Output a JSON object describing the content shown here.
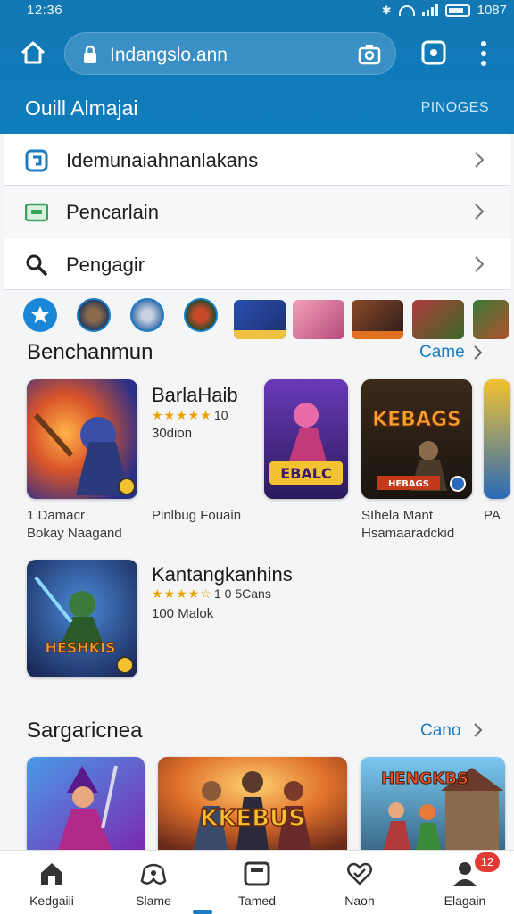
{
  "status_bar": {
    "time": "12:36",
    "battery": "1087"
  },
  "browser": {
    "url": "Indangslo.ann"
  },
  "header": {
    "title": "Ouill Almajai",
    "action": "PINOGES"
  },
  "list_rows": [
    {
      "label": "Idemunaiahnanlakans",
      "icon": "app-square-icon"
    },
    {
      "label": "Pencarlain",
      "icon": "tablet-icon"
    },
    {
      "label": "Pengagir",
      "icon": "search-icon"
    }
  ],
  "section1": {
    "title": "Benchanmun",
    "link": "Came",
    "games": [
      {
        "name": "BarlaHaib",
        "stars": "★★★★★",
        "rating": "10",
        "sub": "30dion",
        "caption": "Pinlbug Fouain"
      },
      {
        "name": "Kantangkanhins",
        "stars": "★★★★☆",
        "rating": "1 0 5Cans",
        "sub": "100 Malok",
        "caption": ""
      }
    ],
    "tile_captions": [
      {
        "line1": "1 Damacr",
        "line2": "Bokay Naagand"
      },
      {
        "line1": "SIhela Mant",
        "line2": "Hsamaaradckid"
      },
      {
        "line1": "PA",
        "line2": ""
      }
    ],
    "tile_art_text": [
      "EBALC",
      "KEBAGS",
      "HEBAGS",
      "HESHKIS"
    ]
  },
  "section2": {
    "title": "Sargaricnea",
    "link": "Cano",
    "tile_art_text": [
      "KKEBUS",
      "HENGKBS"
    ]
  },
  "bottom_nav": [
    {
      "label": "Kedgaiii",
      "icon": "home-icon"
    },
    {
      "label": "Slame",
      "icon": "game-controller-icon"
    },
    {
      "label": "Tamed",
      "icon": "tablet-icon"
    },
    {
      "label": "Naoh",
      "icon": "heart-chat-icon"
    },
    {
      "label": "Elagain",
      "icon": "profile-icon"
    }
  ],
  "notification_badge": "12",
  "colors": {
    "brand": "#1277b3",
    "link": "#1a7cc4",
    "star": "#e8a300",
    "badge": "#e53935"
  }
}
